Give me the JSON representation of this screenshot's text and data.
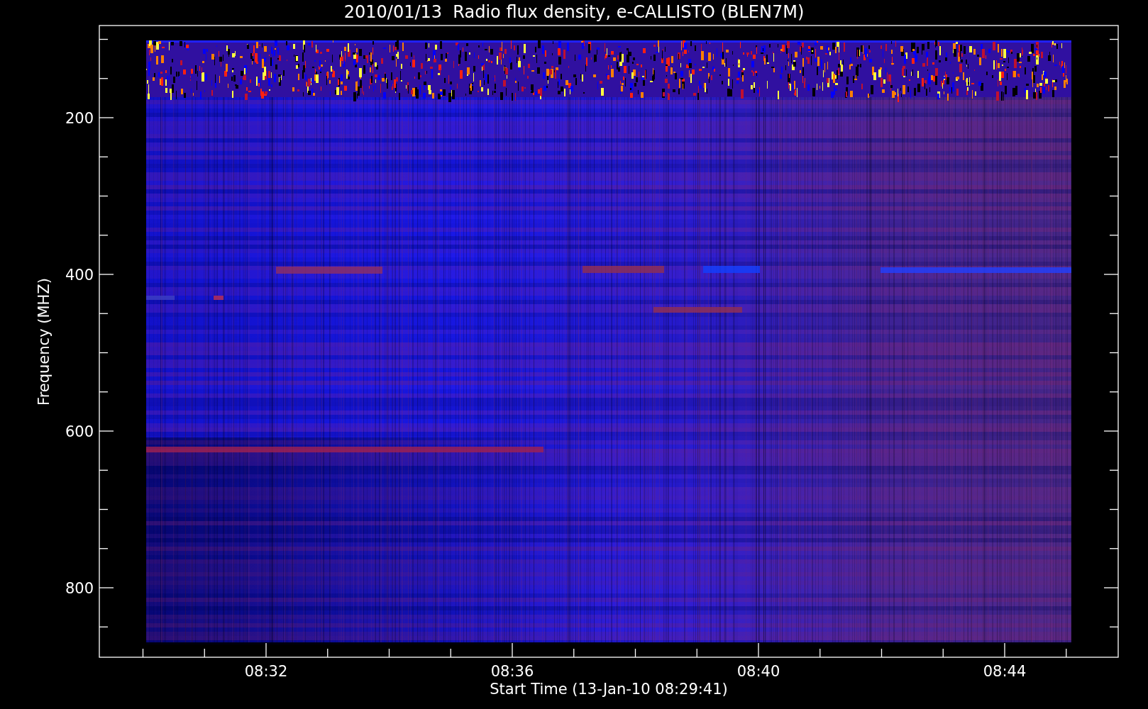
{
  "title": "2010/01/13  Radio flux density, e-CALLISTO (BLEN7M)",
  "y_axis": {
    "label": "Frequency (MHZ)",
    "ticks": [
      "200",
      "400",
      "600",
      "800"
    ]
  },
  "x_axis": {
    "label": "Start Time (13-Jan-10 08:29:41)",
    "ticks": [
      "08:32",
      "08:36",
      "08:40",
      "08:44"
    ]
  }
}
